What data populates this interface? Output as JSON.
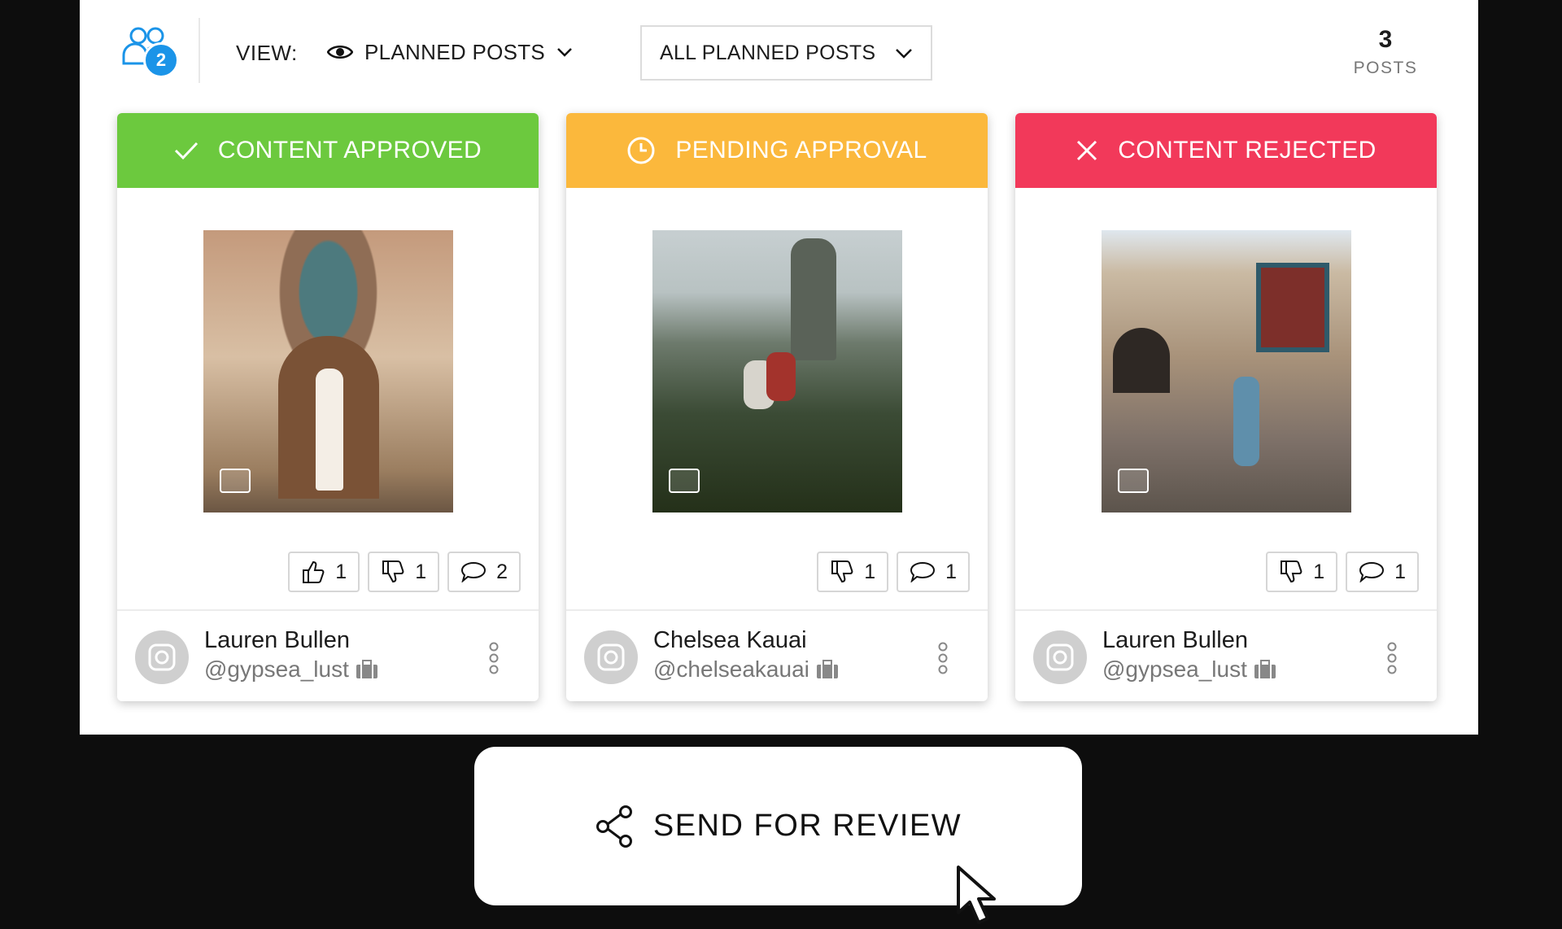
{
  "toolbar": {
    "team_count": "2",
    "view_label": "VIEW:",
    "view_value": "PLANNED POSTS",
    "filter_value": "ALL PLANNED POSTS",
    "post_count": "3",
    "post_count_label": "POSTS"
  },
  "cards": [
    {
      "status": "CONTENT APPROVED",
      "status_color": "#6cc93e",
      "status_icon": "check-icon",
      "likes": "1",
      "dislikes": "1",
      "comments": "2",
      "name": "Lauren Bullen",
      "handle": "@gypsea_lust"
    },
    {
      "status": "PENDING APPROVAL",
      "status_color": "#fbb83c",
      "status_icon": "clock-icon",
      "dislikes": "1",
      "comments": "1",
      "name": "Chelsea Kauai",
      "handle": "@chelseakauai"
    },
    {
      "status": "CONTENT REJECTED",
      "status_color": "#f2395a",
      "status_icon": "close-icon",
      "dislikes": "1",
      "comments": "1",
      "name": "Lauren Bullen",
      "handle": "@gypsea_lust"
    }
  ],
  "send_button": {
    "label": "SEND FOR REVIEW"
  },
  "colors": {
    "accent_blue": "#1b94e8",
    "page_background": "#0d0d0d"
  }
}
